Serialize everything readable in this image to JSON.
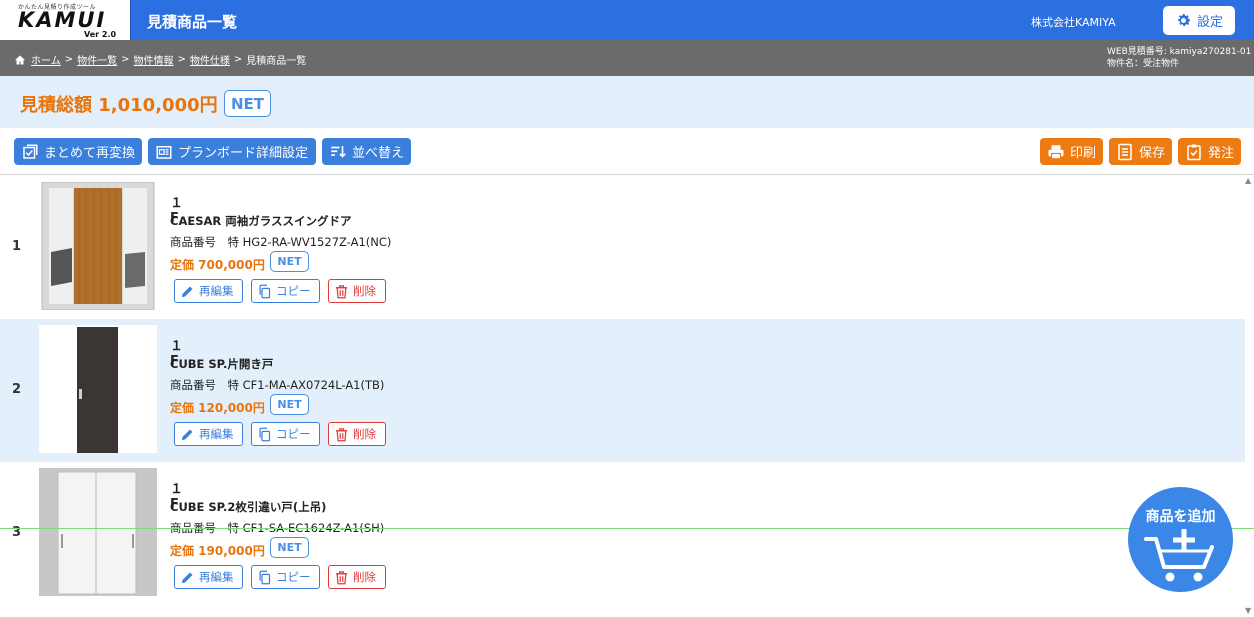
{
  "header": {
    "logo_tagline": "かんたん見積り作成ツール",
    "logo_name": "KAMUI",
    "logo_version": "Ver 2.0",
    "title": "見積商品一覧",
    "company": "株式会社KAMIYA",
    "settings_label": "設定"
  },
  "breadcrumb": {
    "home": "ホーム",
    "sep": ">",
    "items": [
      "物件一覧",
      "物件情報",
      "物件仕様"
    ],
    "current": "見積商品一覧"
  },
  "meta": {
    "estimate_no": "WEB見積番号: kamiya270281-01",
    "property_name": "物件名：受注物件"
  },
  "total": {
    "label": "見積総額 1,010,000円",
    "badge": "NET"
  },
  "toolbar": {
    "reconvert": "まとめて再変換",
    "planboard": "プランボード詳細設定",
    "sort": "並べ替え",
    "print": "印刷",
    "save": "保存",
    "order": "発注"
  },
  "items": [
    {
      "num": "1",
      "floor": "１F",
      "name": "CAESAR 両袖ガラススイングドア",
      "code": "商品番号　特 HG2-RA-WV1527Z-A1(NC)",
      "price": "定価 700,000円",
      "badge": "NET",
      "edit": "再編集",
      "copy": "コピー",
      "delete": "削除"
    },
    {
      "num": "2",
      "floor": "１F",
      "name": "CUBE SP.片開き戸",
      "code": "商品番号　特 CF1-MA-AX0724L-A1(TB)",
      "price": "定価 120,000円",
      "badge": "NET",
      "edit": "再編集",
      "copy": "コピー",
      "delete": "削除"
    },
    {
      "num": "3",
      "floor": "１F",
      "name": "CUBE SP.2枚引違い戸(上吊)",
      "code": "商品番号　特 CF1-SA-EC1624Z-A1(SH)",
      "price": "定価 190,000円",
      "badge": "NET",
      "edit": "再編集",
      "copy": "コピー",
      "delete": "削除"
    }
  ],
  "fab": {
    "label": "商品を追加"
  },
  "colors": {
    "header_blue": "#2c6fe0",
    "accent_orange": "#e8740c",
    "net_blue": "#4a90e2",
    "delete_red": "#e03b3b"
  }
}
